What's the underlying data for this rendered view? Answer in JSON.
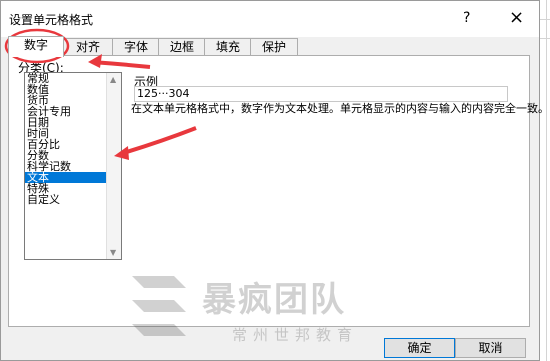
{
  "dialog": {
    "title": "设置单元格格式",
    "help_symbol": "?",
    "close_symbol": "×"
  },
  "tabs": [
    {
      "label": "数字",
      "active": true
    },
    {
      "label": "对齐",
      "active": false
    },
    {
      "label": "字体",
      "active": false
    },
    {
      "label": "边框",
      "active": false
    },
    {
      "label": "填充",
      "active": false
    },
    {
      "label": "保护",
      "active": false
    }
  ],
  "category": {
    "label": "分类(C):",
    "items": [
      "常规",
      "数值",
      "货币",
      "会计专用",
      "日期",
      "时间",
      "百分比",
      "分数",
      "科学记数",
      "文本",
      "特殊",
      "自定义"
    ],
    "selected": "文本"
  },
  "sample": {
    "label": "示例",
    "value": "125···304"
  },
  "description": "在文本单元格格式中，数字作为文本处理。单元格显示的内容与输入的内容完全一致。",
  "buttons": {
    "ok": "确定",
    "cancel": "取消"
  },
  "watermark": {
    "name": "暴疯团队",
    "sub": "常州世邦教育"
  },
  "colors": {
    "annotation": "#e8383d",
    "selection": "#0078d7"
  }
}
